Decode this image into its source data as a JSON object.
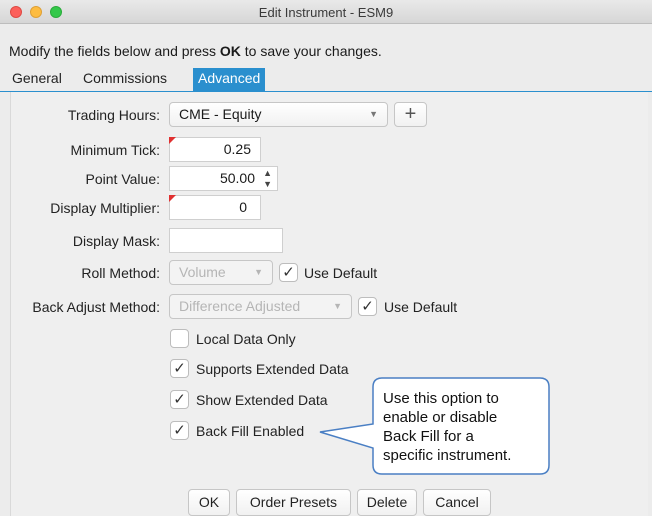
{
  "window": {
    "title": "Edit Instrument - ESM9"
  },
  "instructions": {
    "prefix": "Modify the fields below and press ",
    "bold": "OK",
    "suffix": " to save your changes."
  },
  "tabs": [
    {
      "label": "General",
      "active": false
    },
    {
      "label": "Commissions",
      "active": false
    },
    {
      "label": "Advanced",
      "active": true
    }
  ],
  "form": {
    "trading_hours": {
      "label": "Trading Hours:",
      "value": "CME - Equity",
      "add_icon": "plus-icon"
    },
    "minimum_tick": {
      "label": "Minimum Tick:",
      "value": "0.25"
    },
    "point_value": {
      "label": "Point Value:",
      "value": "50.00"
    },
    "display_multiplier": {
      "label": "Display Multiplier:",
      "value": "0"
    },
    "display_mask": {
      "label": "Display Mask:",
      "value": ""
    },
    "roll_method": {
      "label": "Roll Method:",
      "value": "Volume",
      "use_default_label": "Use Default",
      "use_default_checked": true
    },
    "back_adjust_method": {
      "label": "Back Adjust Method:",
      "value": "Difference Adjusted",
      "use_default_label": "Use Default",
      "use_default_checked": true
    }
  },
  "checkboxes": [
    {
      "label": "Local Data Only",
      "checked": false
    },
    {
      "label": "Supports Extended Data",
      "checked": true
    },
    {
      "label": "Show Extended Data",
      "checked": true
    },
    {
      "label": "Back Fill Enabled",
      "checked": true
    }
  ],
  "callout": {
    "lines": [
      "Use this option to",
      "enable or disable",
      "Back Fill for a",
      "specific instrument."
    ]
  },
  "buttons": {
    "ok": "OK",
    "order_presets": "Order Presets",
    "delete": "Delete",
    "cancel": "Cancel"
  },
  "colors": {
    "accent": "#2a8fce",
    "required_marker": "#e03030",
    "callout_border": "#4a7fc4"
  }
}
